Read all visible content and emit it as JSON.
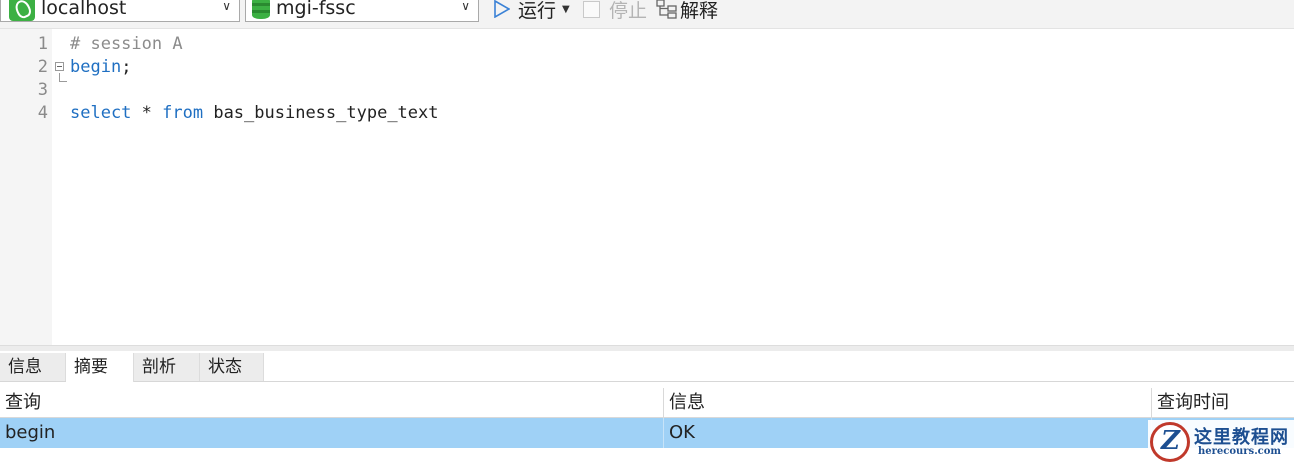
{
  "toolbar": {
    "connection": "localhost",
    "database": "mgi-fssc",
    "run_label": "运行",
    "stop_label": "停止",
    "explain_label": "解释"
  },
  "editor": {
    "lines": [
      {
        "num": "1",
        "comment": "# session A"
      },
      {
        "num": "2",
        "kw": "begin",
        "rest": ";"
      },
      {
        "num": "3"
      },
      {
        "num": "4",
        "kw1": "select",
        "mid": " * ",
        "kw2": "from",
        "rest": " bas_business_type_text"
      }
    ]
  },
  "tabs": [
    "信息",
    "摘要",
    "剖析",
    "状态"
  ],
  "active_tab": "摘要",
  "results": {
    "columns": [
      "查询",
      "信息",
      "查询时间"
    ],
    "rows": [
      {
        "query": "begin",
        "info": "OK",
        "time": ""
      }
    ]
  },
  "watermark": {
    "logo_letter": "Z",
    "title": "这里教程网",
    "url": "herecours.com"
  },
  "colors": {
    "selected_row": "#9fd1f6",
    "keyword": "#1f6fc2",
    "comment": "#8c8c8c",
    "brand_green": "#3cb043"
  }
}
